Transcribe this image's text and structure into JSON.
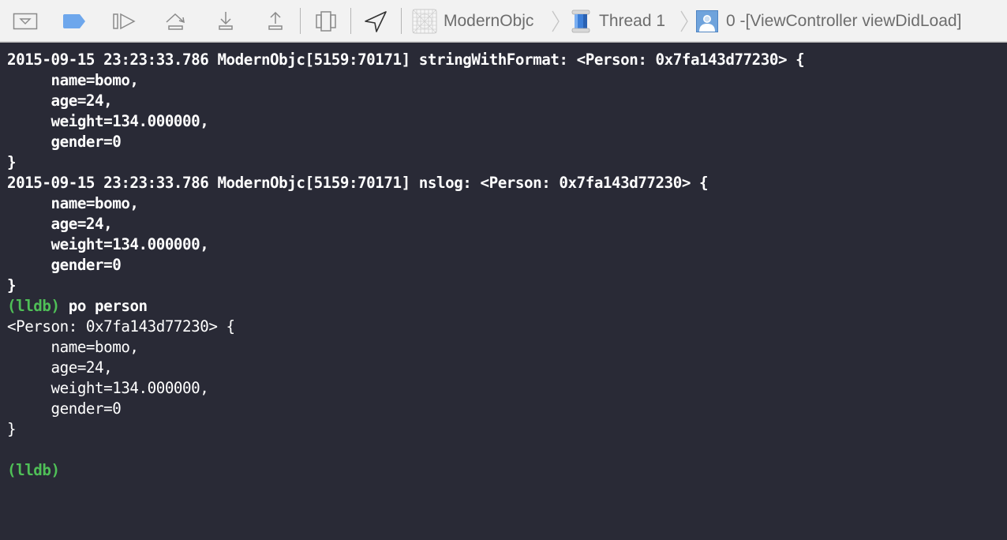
{
  "toolbar": {
    "buttons": [
      {
        "name": "hide-debug-area",
        "icon": "debug-area-toggle-icon"
      },
      {
        "name": "breakpoints-toggle",
        "icon": "breakpoint-icon"
      },
      {
        "name": "continue",
        "icon": "continue-icon"
      },
      {
        "name": "step-over",
        "icon": "step-over-icon"
      },
      {
        "name": "step-into",
        "icon": "step-into-icon"
      },
      {
        "name": "step-out",
        "icon": "step-out-icon"
      },
      {
        "name": "debug-view-hierarchy",
        "icon": "view-hierarchy-icon"
      },
      {
        "name": "simulate-location",
        "icon": "location-arrow-icon"
      }
    ],
    "breadcrumb": {
      "app": "ModernObjc",
      "thread": "Thread 1",
      "frame": "0 -[ViewController viewDidLoad]"
    },
    "colors": {
      "breakpoint_active": "#6ea7ec",
      "prompt": "#4fbf57"
    }
  },
  "console": {
    "log1": {
      "header": "2015-09-15 23:23:33.786 ModernObjc[5159:70171] stringWithFormat: <Person: 0x7fa143d77230> {",
      "fields": [
        "     name=bomo,",
        "     age=24,",
        "     weight=134.000000,",
        "     gender=0"
      ],
      "close": "}"
    },
    "log2": {
      "header": "2015-09-15 23:23:33.786 ModernObjc[5159:70171] nslog: <Person: 0x7fa143d77230> {",
      "fields": [
        "     name=bomo,",
        "     age=24,",
        "     weight=134.000000,",
        "     gender=0"
      ],
      "close": "}"
    },
    "command": {
      "prompt": "(lldb)",
      "text": " po person"
    },
    "output": {
      "header": "<Person: 0x7fa143d77230> {",
      "fields": [
        "     name=bomo,",
        "     age=24,",
        "     weight=134.000000,",
        "     gender=0"
      ],
      "close": "}"
    },
    "final_prompt": "(lldb)"
  }
}
